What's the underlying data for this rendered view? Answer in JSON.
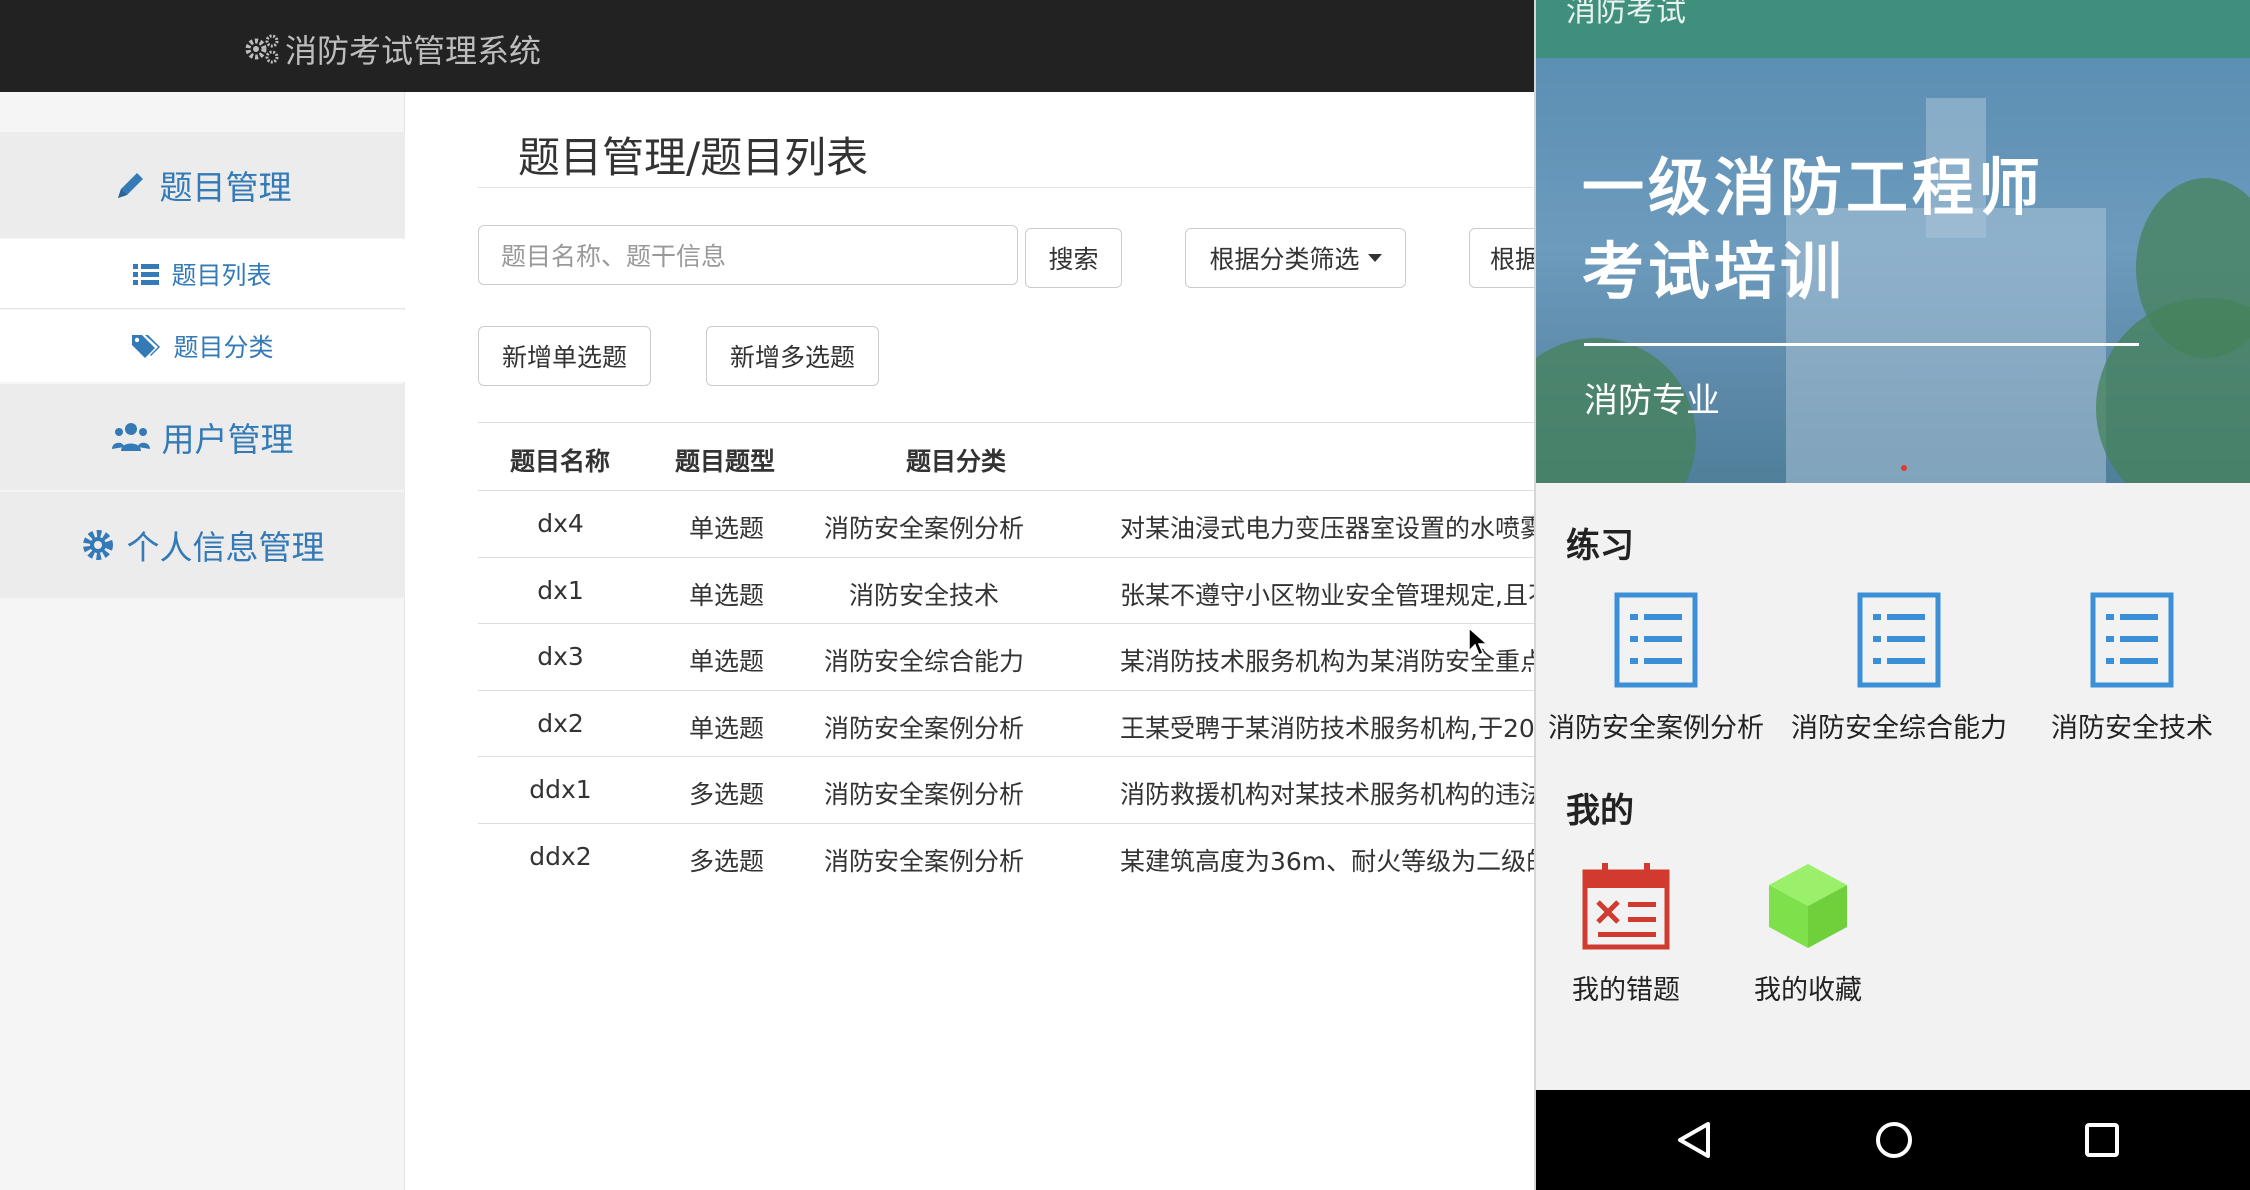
{
  "app": {
    "brand": "消防考试管理系统"
  },
  "sidebar": {
    "groups": [
      {
        "label": "题目管理",
        "icon": "pencil-icon"
      },
      {
        "label": "用户管理",
        "icon": "users-icon"
      },
      {
        "label": "个人信息管理",
        "icon": "gear-icon"
      }
    ],
    "subitems": [
      {
        "label": "题目列表",
        "icon": "list-icon"
      },
      {
        "label": "题目分类",
        "icon": "tags-icon"
      }
    ]
  },
  "main": {
    "title": "题目管理/题目列表",
    "search_placeholder": "题目名称、题干信息",
    "search_button": "搜索",
    "filter_category": "根据分类筛选",
    "filter_type_partial": "根据",
    "add_single": "新增单选题",
    "add_multi": "新增多选题",
    "columns": [
      "题目名称",
      "题目题型",
      "题目分类"
    ],
    "rows": [
      {
        "name": "dx4",
        "type": "单选题",
        "category": "消防安全案例分析",
        "content": "对某油浸式电力变压器室设置的水喷雾"
      },
      {
        "name": "dx1",
        "type": "单选题",
        "category": "消防安全技术",
        "content": "张某不遵守小区物业安全管理规定,且不"
      },
      {
        "name": "dx3",
        "type": "单选题",
        "category": "消防安全综合能力",
        "content": "某消防技术服务机构为某消防安全重点"
      },
      {
        "name": "dx2",
        "type": "单选题",
        "category": "消防安全案例分析",
        "content": "王某受聘于某消防技术服务机构,于20"
      },
      {
        "name": "ddx1",
        "type": "多选题",
        "category": "消防安全案例分析",
        "content": "消防救援机构对某技术服务机构的违法"
      },
      {
        "name": "ddx2",
        "type": "多选题",
        "category": "消防安全案例分析",
        "content": "某建筑高度为36m、耐火等级为二级的"
      }
    ]
  },
  "phone": {
    "appbar_title": "消防考试",
    "banner_title_line1": "一级消防工程师",
    "banner_title_line2": "考试培训",
    "banner_subtitle": "消防专业",
    "practice_title": "练习",
    "practice_items": [
      {
        "label": "消防安全案例分析",
        "icon": "document-list-icon"
      },
      {
        "label": "消防安全综合能力",
        "icon": "document-list-icon"
      },
      {
        "label": "消防安全技术",
        "icon": "document-list-icon"
      }
    ],
    "mine_title": "我的",
    "mine_items": [
      {
        "label": "我的错题",
        "icon": "calendar-x-icon"
      },
      {
        "label": "我的收藏",
        "icon": "cube-icon"
      }
    ],
    "colors": {
      "appbar": "#3f8f7c",
      "practice_icon": "#3a8fd6",
      "wrong_icon": "#d13b2f",
      "favorite_icon": "#7ee04a"
    }
  }
}
